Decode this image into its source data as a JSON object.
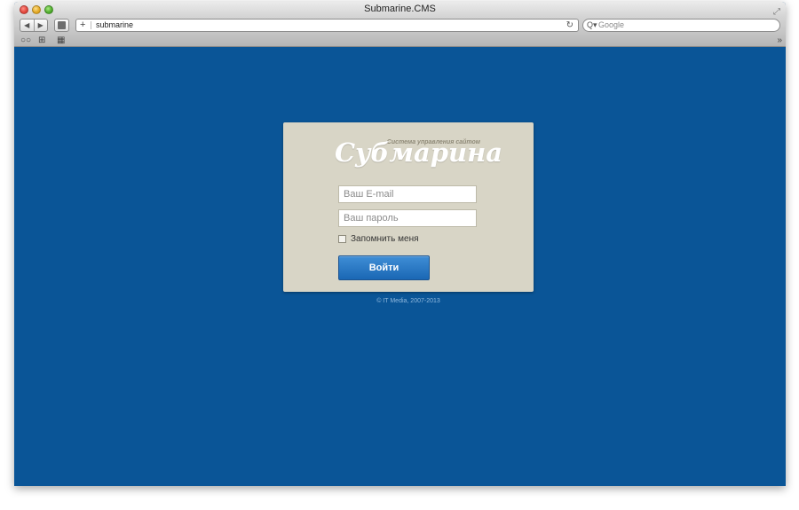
{
  "window": {
    "title": "Submarine.CMS"
  },
  "toolbar": {
    "back_glyph": "◀",
    "forward_glyph": "▶",
    "add_glyph": "+",
    "address": "submarine",
    "reload_glyph": "↻",
    "search_placeholder": "Google",
    "search_glyph": "Q▾"
  },
  "bookmarks": {
    "reading_list_glyph": "○○",
    "bookmarks_glyph": "⊞",
    "top_sites_glyph": "▦",
    "more_glyph": "»"
  },
  "login": {
    "logo_subtitle": "Система управления сайтом",
    "logo_text": "Субмарина",
    "email_placeholder": "Ваш E-mail",
    "password_placeholder": "Ваш пароль",
    "remember_label": "Запомнить меня",
    "submit_label": "Войти"
  },
  "footer": {
    "copyright": "© IT Media, 2007-2013"
  },
  "colors": {
    "page_background": "#0a5597",
    "card_background": "#d8d5c6",
    "button": "#2a7bc6"
  }
}
